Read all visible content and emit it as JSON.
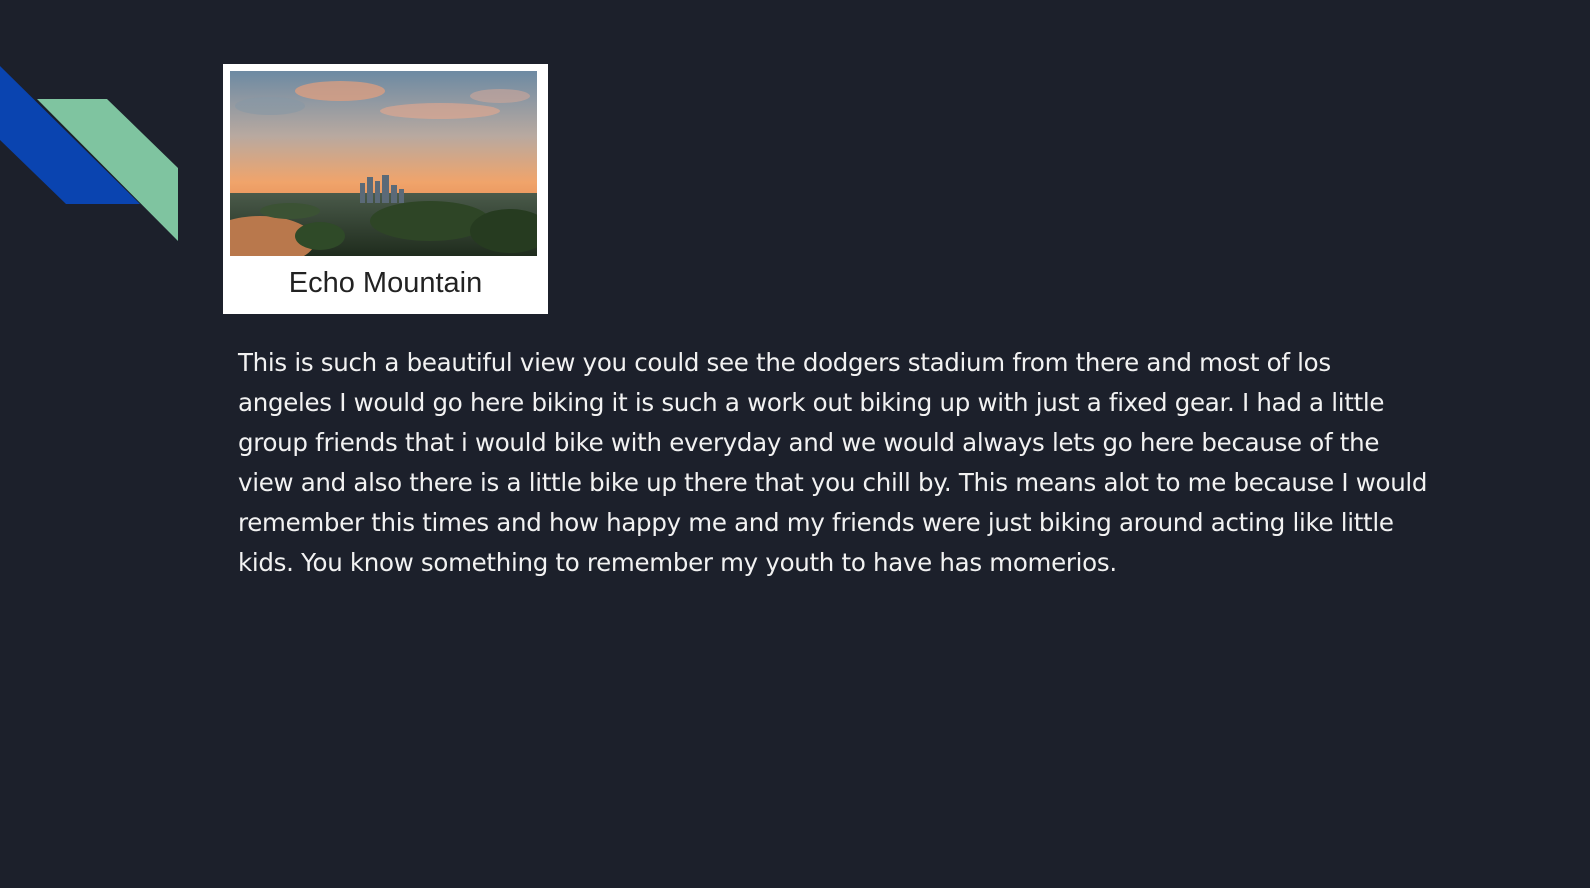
{
  "slide": {
    "image_caption": "Echo Mountain",
    "body": "This is such a beautiful view you could see the dodgers stadium from there and most of los angeles I would go here biking it is such a work out biking up with just a fixed gear. I had a little group friends that i would bike with everyday and we would always lets go here because of the view and also there is a little bike up there that you chill by. This means alot to me because I would remember this times and how happy me and my friends were just biking around acting like little kids. You know something to remember my youth to have has momerios."
  },
  "colors": {
    "background": "#1c202b",
    "accent_blue": "#0a44b0",
    "accent_green": "#7fc4a0",
    "text": "#f2f2f2"
  },
  "icons": [
    "corner-decoration",
    "city-skyline-photo"
  ]
}
